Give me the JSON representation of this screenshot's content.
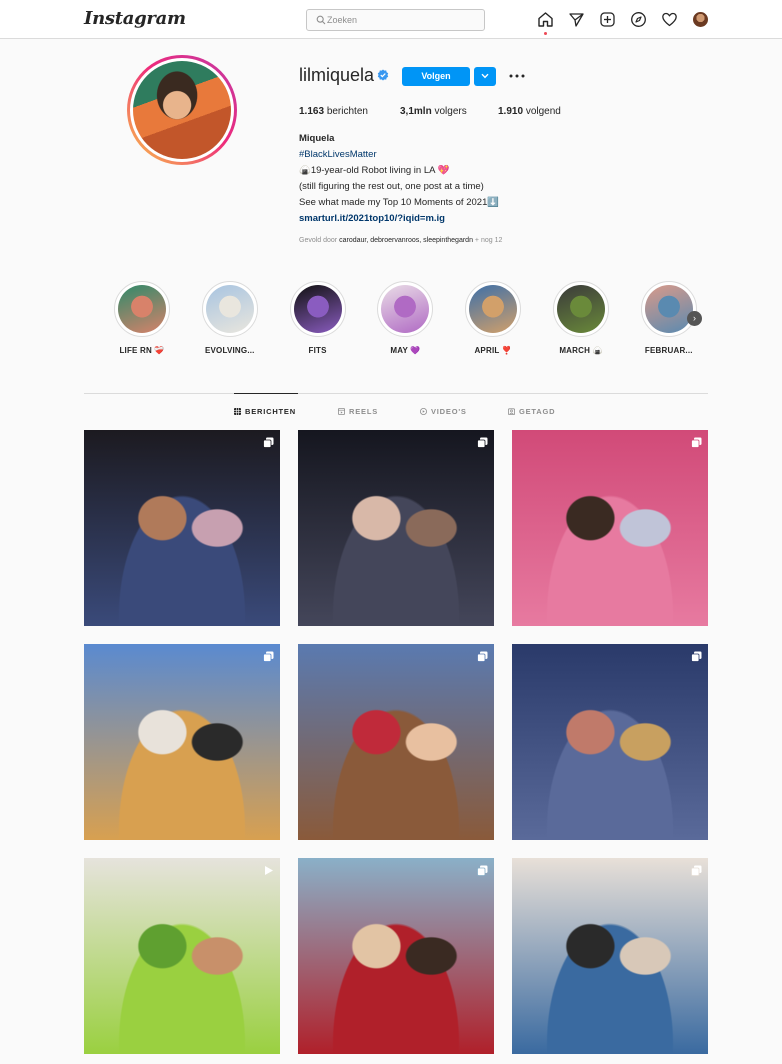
{
  "nav": {
    "logo": "Instagram",
    "search_placeholder": "Zoeken",
    "icons": [
      "home-icon",
      "direct-icon",
      "new-post-icon",
      "explore-icon",
      "activity-heart-icon",
      "profile-avatar"
    ]
  },
  "profile": {
    "username": "lilmiquela",
    "verified": true,
    "follow_label": "Volgen",
    "stats": {
      "posts_count": "1.163",
      "posts_label": "berichten",
      "followers_count": "3,1mln",
      "followers_label": "volgers",
      "following_count": "1.910",
      "following_label": "volgend"
    },
    "bio": {
      "name": "Miquela",
      "hashtag": "#BlackLivesMatter",
      "line1": "🍙19-year-old Robot living in LA 💖",
      "line2": "(still figuring the rest out, one post at a time)",
      "line3": "See what made my Top 10 Moments of 2021⬇️",
      "link": "smarturl.it/2021top10/?iqid=m.ig"
    },
    "followed_by": {
      "prefix": "Gevold door",
      "names": "carodaur, debroervanroos, sleepinthegardn",
      "suffix": "+ nog 12"
    }
  },
  "highlights": [
    {
      "label": "LIFE RN ❤️‍🩹",
      "colors": [
        "#2f8a6a",
        "#d8826a"
      ]
    },
    {
      "label": "EVOLVING...",
      "colors": [
        "#a8c4e0",
        "#e9e6de"
      ]
    },
    {
      "label": "FITS",
      "colors": [
        "#111111",
        "#8a5cc0"
      ]
    },
    {
      "label": "MAY 💜",
      "colors": [
        "#e9dce6",
        "#b06ac4"
      ]
    },
    {
      "label": "APRIL ❣️",
      "colors": [
        "#3d6fa8",
        "#d2a06a"
      ]
    },
    {
      "label": "MARCH 🍙",
      "colors": [
        "#3a3a3a",
        "#6a8a3a"
      ]
    },
    {
      "label": "FEBRUAR...",
      "colors": [
        "#d99a8a",
        "#5a8ab0"
      ]
    }
  ],
  "tabs": [
    {
      "label": "BERICHTEN",
      "active": true,
      "icon": "grid-icon"
    },
    {
      "label": "REELS",
      "active": false,
      "icon": "reels-icon"
    },
    {
      "label": "VIDEO'S",
      "active": false,
      "icon": "play-icon"
    },
    {
      "label": "GETAGD",
      "active": false,
      "icon": "tagged-icon"
    }
  ],
  "posts": [
    {
      "type": "carousel",
      "colors": [
        "#1c1a20",
        "#3a4a7a",
        "#b07a5a",
        "#c7a0b0"
      ]
    },
    {
      "type": "carousel",
      "colors": [
        "#15161f",
        "#44465a",
        "#d8b8a8",
        "#8a6a5a"
      ]
    },
    {
      "type": "carousel",
      "colors": [
        "#d14a78",
        "#e77aa0",
        "#3a2a22",
        "#c0c4d8"
      ]
    },
    {
      "type": "carousel",
      "colors": [
        "#5a8ad0",
        "#d8a050",
        "#e8e2da",
        "#2a2a2a"
      ]
    },
    {
      "type": "carousel",
      "colors": [
        "#5a7ab0",
        "#8a5a3a",
        "#c02a3a",
        "#e8c0a0"
      ]
    },
    {
      "type": "carousel",
      "colors": [
        "#2a3a6a",
        "#5a6a9a",
        "#c07a6a",
        "#c8a060"
      ]
    },
    {
      "type": "video",
      "colors": [
        "#e6e3dc",
        "#9ad040",
        "#5fa030",
        "#c8906a"
      ]
    },
    {
      "type": "carousel",
      "colors": [
        "#8ab0c8",
        "#b0202a",
        "#e2c4a4",
        "#3a2a22"
      ]
    },
    {
      "type": "carousel",
      "colors": [
        "#e8e0d8",
        "#3a6aa0",
        "#2a2a2a",
        "#d8c8b8"
      ]
    }
  ]
}
